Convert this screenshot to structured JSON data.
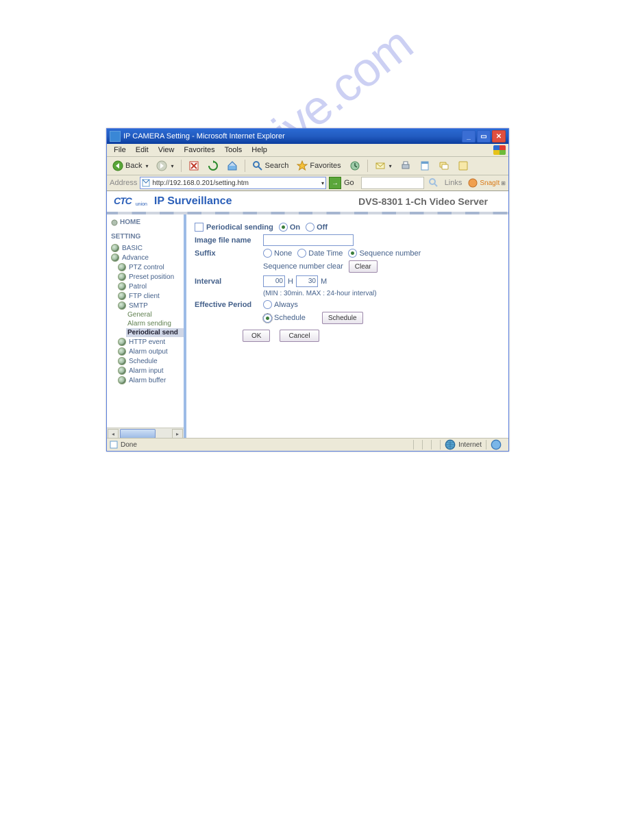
{
  "window": {
    "title": "IP CAMERA Setting - Microsoft Internet Explorer"
  },
  "menu": {
    "file": "File",
    "edit": "Edit",
    "view": "View",
    "favorites": "Favorites",
    "tools": "Tools",
    "help": "Help"
  },
  "toolbar": {
    "back": "Back",
    "search": "Search",
    "favorites": "Favorites"
  },
  "address": {
    "label": "Address",
    "url": "http://192.168.0.201/setting.htm",
    "go": "Go",
    "links": "Links",
    "snagit": "SnagIt"
  },
  "brand": {
    "ctc": "CTC",
    "union": "union",
    "title": "IP Surveillance",
    "product": "DVS-8301 1-Ch Video Server"
  },
  "tree": {
    "home": "HOME",
    "setting": "SETTING",
    "basic": "BASIC",
    "advance": "Advance",
    "ptz": "PTZ control",
    "preset": "Preset position",
    "patrol": "Patrol",
    "ftp": "FTP client",
    "smtp": "SMTP",
    "general": "General",
    "alarm_sending": "Alarm sending",
    "periodical": "Periodical send",
    "http_event": "HTTP event",
    "alarm_output": "Alarm output",
    "schedule": "Schedule",
    "alarm_input": "Alarm input",
    "alarm_buffer": "Alarm buffer"
  },
  "form": {
    "periodical_sending": "Periodical sending",
    "on": "On",
    "off": "Off",
    "image_file_name": "Image file name",
    "suffix": "Suffix",
    "none": "None",
    "date_time": "Date Time",
    "sequence_number": "Sequence number",
    "seq_clear": "Sequence number clear",
    "clear": "Clear",
    "interval": "Interval",
    "interval_h": "00",
    "interval_m": "30",
    "h": "H",
    "m": "M",
    "interval_hint": "(MIN : 30min. MAX : 24-hour interval)",
    "effective_period": "Effective Period",
    "always": "Always",
    "schedule": "Schedule",
    "schedule_btn": "Schedule",
    "ok": "OK",
    "cancel": "Cancel"
  },
  "status": {
    "done": "Done",
    "zone": "Internet"
  },
  "watermark": "manualshive.com"
}
